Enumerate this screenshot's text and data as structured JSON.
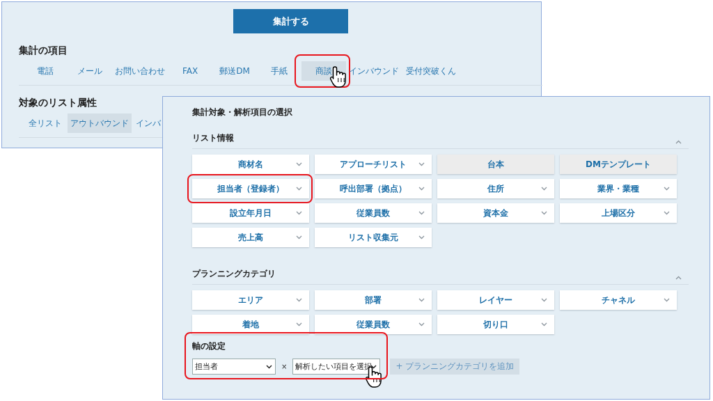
{
  "back_panel": {
    "submit_button": "集計する",
    "sections": [
      {
        "title": "集計の項目",
        "tabs": [
          {
            "label": "電話",
            "selected": false,
            "highlighted": false,
            "cursor": false
          },
          {
            "label": "メール",
            "selected": false,
            "highlighted": false,
            "cursor": false
          },
          {
            "label": "お問い合わせ",
            "selected": false,
            "highlighted": false,
            "cursor": false
          },
          {
            "label": "FAX",
            "selected": false,
            "highlighted": false,
            "cursor": false
          },
          {
            "label": "郵送DM",
            "selected": false,
            "highlighted": false,
            "cursor": false
          },
          {
            "label": "手紙",
            "selected": false,
            "highlighted": false,
            "cursor": false
          },
          {
            "label": "商談",
            "selected": true,
            "highlighted": true,
            "cursor": true
          },
          {
            "label": "インバウンド",
            "selected": false,
            "highlighted": false,
            "cursor": false
          },
          {
            "label": "受付突破くん",
            "selected": false,
            "highlighted": false,
            "cursor": false
          }
        ]
      },
      {
        "title": "対象のリスト属性",
        "tabs": [
          {
            "label": "全リスト",
            "selected": false,
            "highlighted": false,
            "cursor": false
          },
          {
            "label": "アウトバウンド",
            "selected": true,
            "highlighted": false,
            "cursor": false
          },
          {
            "label": "インバ",
            "selected": false,
            "highlighted": false,
            "cursor": false
          }
        ]
      }
    ]
  },
  "front_panel": {
    "title": "集計対象・解析項目の選択",
    "groups": [
      {
        "title": "リスト情報",
        "expanded": true,
        "items": [
          {
            "label": "商材名",
            "disabled": false,
            "highlighted": false
          },
          {
            "label": "アプローチリスト",
            "disabled": false,
            "highlighted": false
          },
          {
            "label": "台本",
            "disabled": true,
            "highlighted": false
          },
          {
            "label": "DMテンプレート",
            "disabled": true,
            "highlighted": false
          },
          {
            "label": "担当者（登録者）",
            "disabled": false,
            "highlighted": true
          },
          {
            "label": "呼出部署（拠点）",
            "disabled": false,
            "highlighted": false
          },
          {
            "label": "住所",
            "disabled": false,
            "highlighted": false
          },
          {
            "label": "業界・業種",
            "disabled": false,
            "highlighted": false
          },
          {
            "label": "設立年月日",
            "disabled": false,
            "highlighted": false
          },
          {
            "label": "従業員数",
            "disabled": false,
            "highlighted": false
          },
          {
            "label": "資本金",
            "disabled": false,
            "highlighted": false
          },
          {
            "label": "上場区分",
            "disabled": false,
            "highlighted": false
          },
          {
            "label": "売上高",
            "disabled": false,
            "highlighted": false
          },
          {
            "label": "リスト収集元",
            "disabled": false,
            "highlighted": false
          }
        ]
      },
      {
        "title": "プランニングカテゴリ",
        "expanded": true,
        "items": [
          {
            "label": "エリア",
            "disabled": false,
            "highlighted": false
          },
          {
            "label": "部署",
            "disabled": false,
            "highlighted": false
          },
          {
            "label": "レイヤー",
            "disabled": false,
            "highlighted": false
          },
          {
            "label": "チャネル",
            "disabled": false,
            "highlighted": false
          },
          {
            "label": "着地",
            "disabled": false,
            "highlighted": false
          },
          {
            "label": "従業員数",
            "disabled": false,
            "highlighted": false
          },
          {
            "label": "切り口",
            "disabled": false,
            "highlighted": false
          }
        ]
      }
    ],
    "axis": {
      "title": "軸の設定",
      "highlighted": true,
      "selects": [
        {
          "value": "担当者",
          "cursor": false
        },
        {
          "value": "解析したい項目を選択",
          "cursor": true
        }
      ],
      "separator": "×",
      "add_button": "+ プランニングカテゴリを追加"
    }
  }
}
